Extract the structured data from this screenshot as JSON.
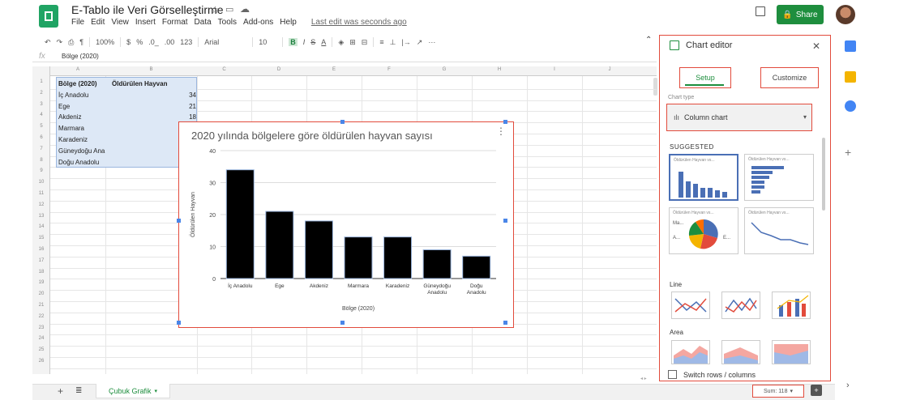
{
  "header": {
    "title": "E-Tablo ile Veri Görselleştirme",
    "menu": [
      "File",
      "Edit",
      "View",
      "Insert",
      "Format",
      "Data",
      "Tools",
      "Add-ons",
      "Help"
    ],
    "last_edit": "Last edit was seconds ago",
    "share_label": "Share"
  },
  "toolbar": {
    "zoom": "100%",
    "currency": "$",
    "percent": "%",
    "dec_less": ".0_",
    "dec_more": ".00",
    "format_more": "123",
    "font": "Arial",
    "font_size": "10",
    "bold": "B",
    "italic": "I",
    "strike": "S",
    "text_color": "A",
    "more": "···"
  },
  "formula_bar": {
    "fx": "fx",
    "value": "Bölge (2020)"
  },
  "sheet": {
    "columns": [
      "A",
      "B",
      "C",
      "D",
      "E",
      "F",
      "G",
      "H",
      "I",
      "J"
    ],
    "rows": [
      "1",
      "2",
      "3",
      "4",
      "5",
      "6",
      "7",
      "8",
      "9",
      "10",
      "11",
      "12",
      "13",
      "14",
      "15",
      "16",
      "17",
      "18",
      "19",
      "20",
      "21",
      "22",
      "23",
      "24",
      "25",
      "26"
    ],
    "header_a": "Bölge (2020)",
    "header_b": "Öldürülen Hayvan",
    "regions": [
      "İç Anadolu",
      "Ege",
      "Akdeniz",
      "Marmara",
      "Karadeniz",
      "Güneydoğu Ana",
      "Doğu Anadolu"
    ],
    "values": [
      "34",
      "21",
      "18"
    ]
  },
  "chart_data": {
    "type": "bar",
    "title": "2020 yılında bölgelere göre öldürülen hayvan sayısı",
    "xlabel": "Bölge (2020)",
    "ylabel": "Öldürülen Hayvan",
    "categories": [
      "İç Anadolu",
      "Ege",
      "Akdeniz",
      "Marmara",
      "Karadeniz",
      "Güneydoğu Anadolu",
      "Doğu Anadolu"
    ],
    "values": [
      34,
      21,
      18,
      13,
      13,
      9,
      7
    ],
    "ylim": [
      0,
      40
    ],
    "yticks": [
      0,
      10,
      20,
      30,
      40
    ],
    "grid": true,
    "bar_color": "#000000"
  },
  "editor": {
    "title": "Chart editor",
    "tab_setup": "Setup",
    "tab_customize": "Customize",
    "chart_type_label": "Chart type",
    "chart_type_value": "Column chart",
    "suggested": "SUGGESTED",
    "thumb_title": "Öldürülen Hayvan vs...",
    "pie_labels": [
      "Ma...",
      "A...",
      "E..."
    ],
    "line_label": "Line",
    "area_label": "Area",
    "switch_label": "Switch rows / columns"
  },
  "bottom": {
    "sheet_tab": "Çubuk Grafik",
    "sum": "Sum: 118"
  },
  "colors": {
    "accent_green": "#1e8e3e",
    "highlight_red": "#e24b3c",
    "selection_blue": "#dde8f6"
  }
}
